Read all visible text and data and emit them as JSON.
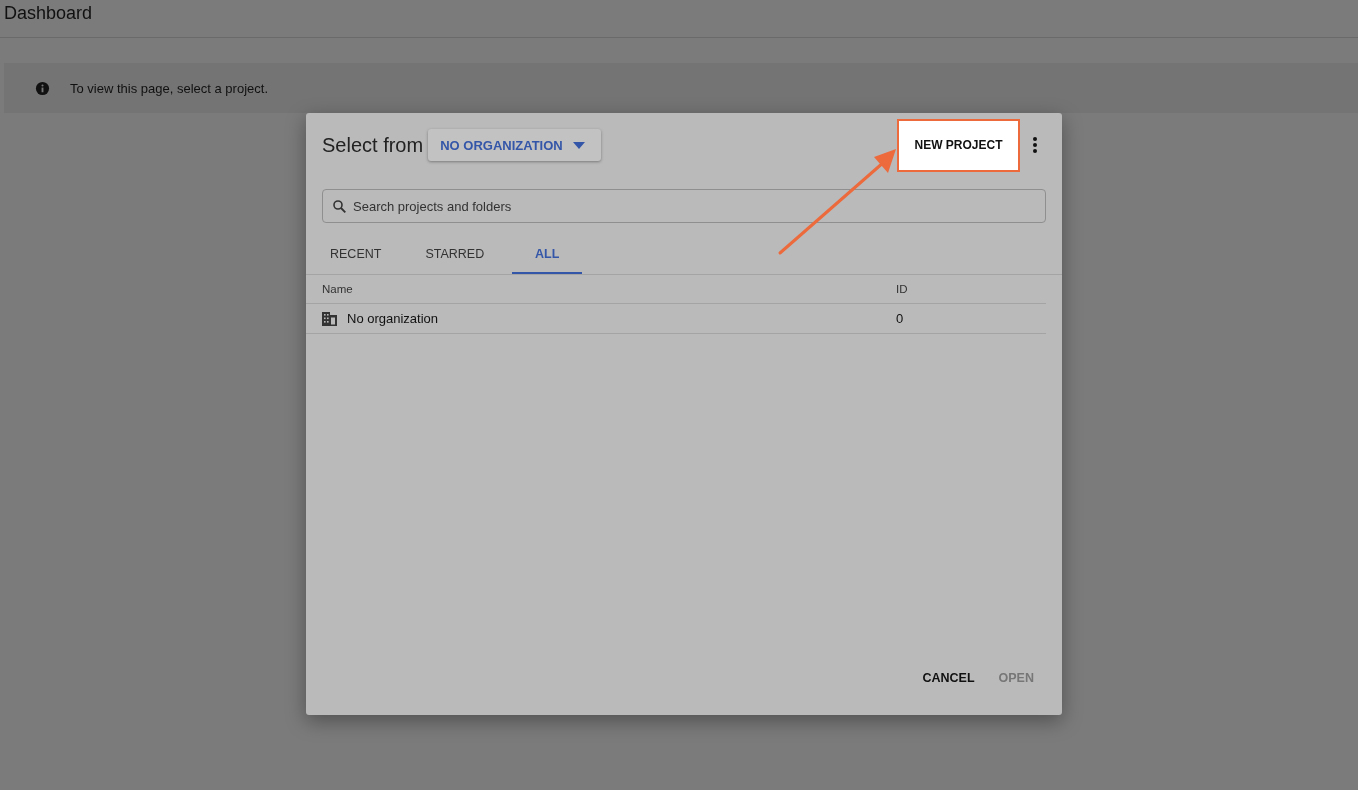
{
  "page": {
    "title": "Dashboard"
  },
  "banner": {
    "text": "To view this page, select a project."
  },
  "dialog": {
    "title": "Select from",
    "organization_dropdown": "NO ORGANIZATION",
    "new_project_button": "NEW PROJECT",
    "search": {
      "placeholder": "Search projects and folders"
    },
    "tabs": [
      {
        "label": "RECENT",
        "selected": false
      },
      {
        "label": "STARRED",
        "selected": false
      },
      {
        "label": "ALL",
        "selected": true
      }
    ],
    "table": {
      "columns": [
        "Name",
        "ID"
      ],
      "rows": [
        {
          "name": "No organization",
          "id": "0"
        }
      ]
    },
    "buttons": [
      {
        "label": "CANCEL",
        "disabled": false
      },
      {
        "label": "OPEN",
        "disabled": true
      }
    ]
  }
}
